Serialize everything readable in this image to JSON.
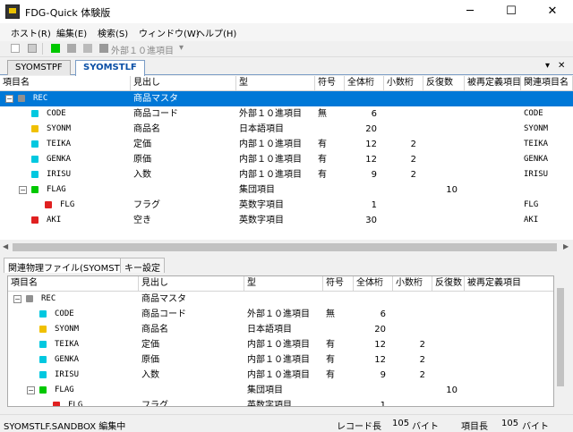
{
  "window": {
    "title": "FDG-Quick 体験版",
    "min": "─",
    "max": "☐",
    "close": "✕"
  },
  "menu": [
    "ホスト(R)",
    "編集(E)",
    "検索(S)",
    "ウィンドウ(W)",
    "ヘルプ(H)"
  ],
  "toolbar": {
    "label": "外部１０進項目",
    "dropdown": "▾"
  },
  "tabs": [
    {
      "label": "SYOMSTPF",
      "active": false
    },
    {
      "label": "SYOMSTLF",
      "active": true
    }
  ],
  "tab_controls": {
    "menu": "▾",
    "close": "✕"
  },
  "colors": {
    "selected": "#0078d7",
    "cyan": "#00c8e0",
    "yellow": "#f0c000",
    "green": "#00c800",
    "red": "#e02020",
    "gray": "#909090"
  },
  "top_grid": {
    "columns": [
      "項目名",
      "見出し",
      "型",
      "符号",
      "全体桁",
      "小数桁",
      "反復数",
      "被再定義項目",
      "関連項目名"
    ],
    "rows": [
      {
        "level": 0,
        "expander": "−",
        "color": "gray",
        "name": "REC",
        "heading": "商品マスタ",
        "type": "",
        "sign": "",
        "total": "",
        "dec": "",
        "rep": "",
        "redef": "",
        "related": "",
        "selected": true
      },
      {
        "level": 1,
        "expander": "",
        "color": "cyan",
        "name": "CODE",
        "heading": "商品コード",
        "type": "外部１０進項目",
        "sign": "無",
        "total": "6",
        "dec": "",
        "rep": "",
        "redef": "",
        "related": "CODE"
      },
      {
        "level": 1,
        "expander": "",
        "color": "yellow",
        "name": "SYONM",
        "heading": "商品名",
        "type": "日本語項目",
        "sign": "",
        "total": "20",
        "dec": "",
        "rep": "",
        "redef": "",
        "related": "SYONM"
      },
      {
        "level": 1,
        "expander": "",
        "color": "cyan",
        "name": "TEIKA",
        "heading": "定価",
        "type": "内部１０進項目",
        "sign": "有",
        "total": "12",
        "dec": "2",
        "rep": "",
        "redef": "",
        "related": "TEIKA"
      },
      {
        "level": 1,
        "expander": "",
        "color": "cyan",
        "name": "GENKA",
        "heading": "原価",
        "type": "内部１０進項目",
        "sign": "有",
        "total": "12",
        "dec": "2",
        "rep": "",
        "redef": "",
        "related": "GENKA"
      },
      {
        "level": 1,
        "expander": "",
        "color": "cyan",
        "name": "IRISU",
        "heading": "入数",
        "type": "内部１０進項目",
        "sign": "有",
        "total": "9",
        "dec": "2",
        "rep": "",
        "redef": "",
        "related": "IRISU"
      },
      {
        "level": 1,
        "expander": "−",
        "color": "green",
        "name": "FLAG",
        "heading": "",
        "type": "集団項目",
        "sign": "",
        "total": "",
        "dec": "",
        "rep": "10",
        "redef": "",
        "related": ""
      },
      {
        "level": 2,
        "expander": "",
        "color": "red",
        "name": "FLG",
        "heading": "フラグ",
        "type": "英数字項目",
        "sign": "",
        "total": "1",
        "dec": "",
        "rep": "",
        "redef": "",
        "related": "FLG"
      },
      {
        "level": 1,
        "expander": "",
        "color": "red",
        "name": "AKI",
        "heading": "空き",
        "type": "英数字項目",
        "sign": "",
        "total": "30",
        "dec": "",
        "rep": "",
        "redef": "",
        "related": "AKI"
      }
    ]
  },
  "lower_tabs": [
    "関連物理ファイル(SYOMSTPF)",
    "キー設定"
  ],
  "bottom_grid": {
    "columns": [
      "項目名",
      "見出し",
      "型",
      "符号",
      "全体桁",
      "小数桁",
      "反復数",
      "被再定義項目"
    ],
    "rows": [
      {
        "level": 0,
        "expander": "−",
        "color": "gray",
        "name": "REC",
        "heading": "商品マスタ",
        "type": "",
        "sign": "",
        "total": "",
        "dec": "",
        "rep": "",
        "redef": ""
      },
      {
        "level": 1,
        "expander": "",
        "color": "cyan",
        "name": "CODE",
        "heading": "商品コード",
        "type": "外部１０進項目",
        "sign": "無",
        "total": "6",
        "dec": "",
        "rep": "",
        "redef": ""
      },
      {
        "level": 1,
        "expander": "",
        "color": "yellow",
        "name": "SYONM",
        "heading": "商品名",
        "type": "日本語項目",
        "sign": "",
        "total": "20",
        "dec": "",
        "rep": "",
        "redef": ""
      },
      {
        "level": 1,
        "expander": "",
        "color": "cyan",
        "name": "TEIKA",
        "heading": "定価",
        "type": "内部１０進項目",
        "sign": "有",
        "total": "12",
        "dec": "2",
        "rep": "",
        "redef": ""
      },
      {
        "level": 1,
        "expander": "",
        "color": "cyan",
        "name": "GENKA",
        "heading": "原価",
        "type": "内部１０進項目",
        "sign": "有",
        "total": "12",
        "dec": "2",
        "rep": "",
        "redef": ""
      },
      {
        "level": 1,
        "expander": "",
        "color": "cyan",
        "name": "IRISU",
        "heading": "入数",
        "type": "内部１０進項目",
        "sign": "有",
        "total": "9",
        "dec": "2",
        "rep": "",
        "redef": ""
      },
      {
        "level": 1,
        "expander": "−",
        "color": "green",
        "name": "FLAG",
        "heading": "",
        "type": "集団項目",
        "sign": "",
        "total": "",
        "dec": "",
        "rep": "10",
        "redef": ""
      },
      {
        "level": 2,
        "expander": "",
        "color": "red",
        "name": "FLG",
        "heading": "フラグ",
        "type": "英数字項目",
        "sign": "",
        "total": "1",
        "dec": "",
        "rep": "",
        "redef": ""
      }
    ]
  },
  "status": {
    "left": "SYOMSTLF.SANDBOX 編集中",
    "record_label": "レコード長",
    "record_value": "105",
    "record_unit": "バイト",
    "item_label": "項目長",
    "item_value": "105",
    "item_unit": "バイト"
  }
}
